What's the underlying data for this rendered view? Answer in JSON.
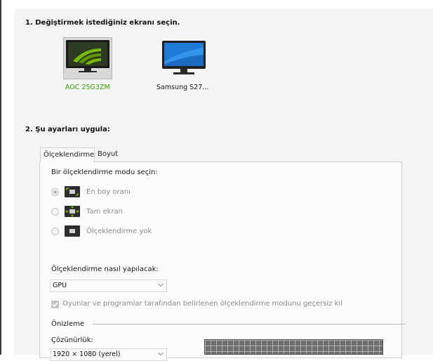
{
  "section1": {
    "title": "1. Değiştirmek istediğiniz ekranı seçin."
  },
  "displays": [
    {
      "name": "AOC 25G3ZM",
      "selected": true,
      "name_color": "#3aa300"
    },
    {
      "name": "Samsung S27...",
      "selected": false,
      "name_color": "#1a1a1a"
    }
  ],
  "section2": {
    "title": "2. Şu ayarları uygula:"
  },
  "tabs": [
    {
      "label": "Ölçeklendirme",
      "active": true
    },
    {
      "label": "Boyut",
      "active": false
    }
  ],
  "scaling": {
    "mode_prompt": "Bir ölçeklendirme modu seçin:",
    "modes": [
      {
        "label": "En boy oranı",
        "selected": true,
        "icon": "aspect-ratio-icon"
      },
      {
        "label": "Tam ekran",
        "selected": false,
        "icon": "full-screen-icon"
      },
      {
        "label": "Ölçeklendirme yok",
        "selected": false,
        "icon": "no-scaling-icon"
      }
    ],
    "performed_on_label": "Ölçeklendirme nasıl yapılacak:",
    "performed_on_value": "GPU",
    "override_checkbox_label": "Oyunlar ve programlar tarafından belirlenen ölçeklendirme modunu geçersiz kıl",
    "override_checked": true
  },
  "preview": {
    "label": "Önizleme",
    "resolution_label": "Çözünürlük:",
    "resolution_value": "1920 × 1080 (yerel)"
  },
  "colors": {
    "accent_green": "#76b900",
    "panel_bg": "#f4f4f4"
  }
}
